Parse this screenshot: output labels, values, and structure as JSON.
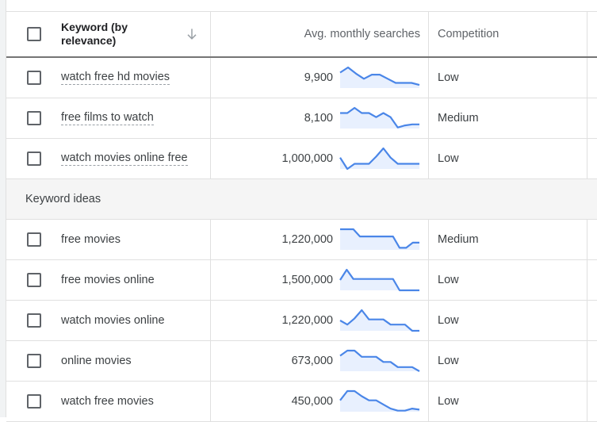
{
  "header": {
    "keyword_label": "Keyword (by relevance)",
    "sort_icon": "arrow-down-icon",
    "searches_label": "Avg. monthly searches",
    "competition_label": "Competition"
  },
  "colors": {
    "sparkline_line": "#4a86e8",
    "sparkline_fill": "#e8f0fe",
    "header_divider": "#757575",
    "section_bg": "#f5f5f5"
  },
  "entered_keywords": [
    {
      "keyword": "watch free hd movies",
      "searches": "9,900",
      "competition": "Low",
      "trend": [
        0.75,
        1.0,
        0.7,
        0.45,
        0.65,
        0.65,
        0.45,
        0.25,
        0.25,
        0.25,
        0.15
      ]
    },
    {
      "keyword": "free films to watch",
      "searches": "8,100",
      "competition": "Medium",
      "trend": [
        0.75,
        0.75,
        1.0,
        0.75,
        0.75,
        0.55,
        0.75,
        0.55,
        0.05,
        0.15,
        0.2,
        0.2
      ]
    },
    {
      "keyword": "watch movies online free",
      "searches": "1,000,000",
      "competition": "Low",
      "trend": [
        0.55,
        0.0,
        0.25,
        0.25,
        0.25,
        0.6,
        1.0,
        0.55,
        0.25,
        0.25,
        0.25,
        0.25
      ]
    }
  ],
  "section": {
    "label": "Keyword ideas"
  },
  "keyword_ideas": [
    {
      "keyword": "free movies",
      "searches": "1,220,000",
      "competition": "Medium",
      "trend": [
        1.0,
        1.0,
        1.0,
        0.65,
        0.65,
        0.65,
        0.65,
        0.65,
        0.65,
        0.1,
        0.1,
        0.35,
        0.35
      ]
    },
    {
      "keyword": "free movies online",
      "searches": "1,500,000",
      "competition": "Low",
      "trend": [
        0.5,
        1.0,
        0.55,
        0.55,
        0.55,
        0.55,
        0.55,
        0.55,
        0.55,
        0.0,
        0.0,
        0.0,
        0.0
      ]
    },
    {
      "keyword": "watch movies online",
      "searches": "1,220,000",
      "competition": "Low",
      "trend": [
        0.5,
        0.3,
        0.6,
        1.0,
        0.55,
        0.55,
        0.55,
        0.3,
        0.3,
        0.3,
        0.0,
        0.0
      ]
    },
    {
      "keyword": "online movies",
      "searches": "673,000",
      "competition": "Low",
      "trend": [
        0.75,
        1.0,
        1.0,
        0.7,
        0.7,
        0.7,
        0.45,
        0.45,
        0.2,
        0.2,
        0.2,
        0.0
      ]
    },
    {
      "keyword": "watch free movies",
      "searches": "450,000",
      "competition": "Low",
      "trend": [
        0.55,
        1.0,
        1.0,
        0.75,
        0.55,
        0.55,
        0.35,
        0.15,
        0.05,
        0.05,
        0.15,
        0.1
      ]
    }
  ]
}
